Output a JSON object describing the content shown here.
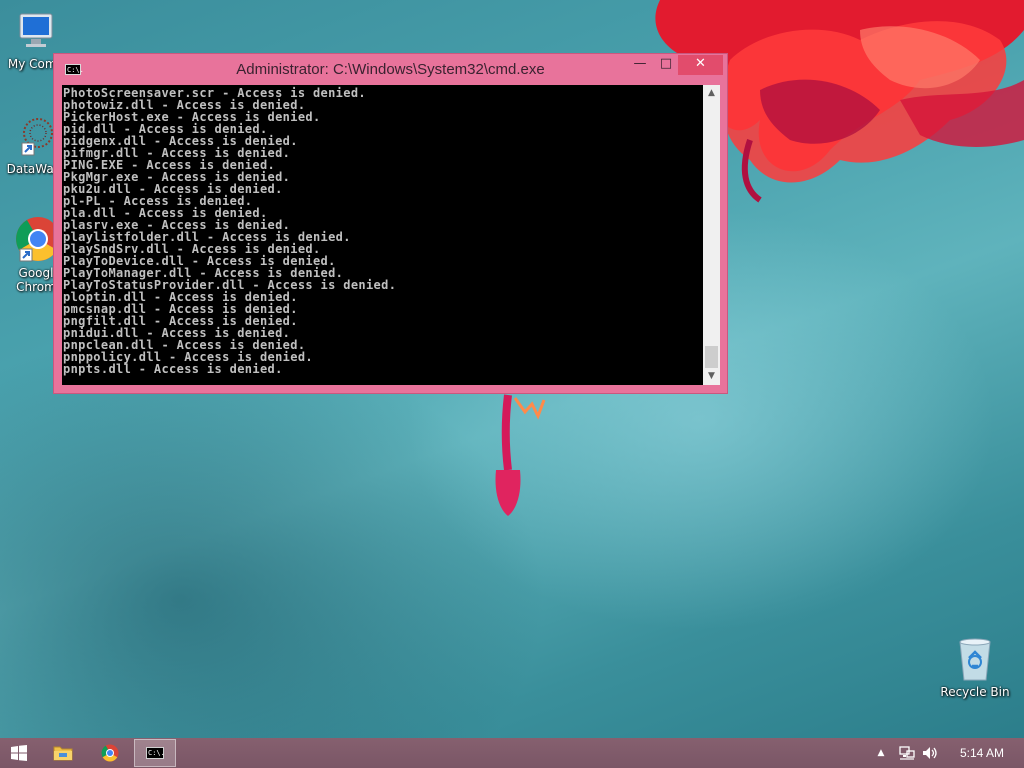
{
  "desktop": {
    "icons": [
      {
        "label": "My Comp",
        "icon": "computer-icon"
      },
      {
        "label": "DataWag",
        "icon": "datawag-icon"
      },
      {
        "label": "Googl",
        "label2": "Chrom",
        "icon": "chrome-icon"
      },
      {
        "label": "Recycle Bin",
        "icon": "recycle-bin-icon"
      }
    ]
  },
  "window": {
    "title": "Administrator:  C:\\Windows\\System32\\cmd.exe",
    "icon_text": "C:\\.",
    "minimize_glyph": "—",
    "maximize_glyph": "□",
    "close_glyph": "✕"
  },
  "console": {
    "lines": [
      "PhotoScreensaver.scr - Access is denied.",
      "photowiz.dll - Access is denied.",
      "PickerHost.exe - Access is denied.",
      "pid.dll - Access is denied.",
      "pidgenx.dll - Access is denied.",
      "pifmgr.dll - Access is denied.",
      "PING.EXE - Access is denied.",
      "PkgMgr.exe - Access is denied.",
      "pku2u.dll - Access is denied.",
      "pl-PL - Access is denied.",
      "pla.dll - Access is denied.",
      "plasrv.exe - Access is denied.",
      "playlistfolder.dll - Access is denied.",
      "PlaySndSrv.dll - Access is denied.",
      "PlayToDevice.dll - Access is denied.",
      "PlayToManager.dll - Access is denied.",
      "PlayToStatusProvider.dll - Access is denied.",
      "ploptin.dll - Access is denied.",
      "pmcsnap.dll - Access is denied.",
      "pngfilt.dll - Access is denied.",
      "pnidui.dll - Access is denied.",
      "pnpclean.dll - Access is denied.",
      "pnppolicy.dll - Access is denied.",
      "pnpts.dll - Access is denied."
    ]
  },
  "taskbar": {
    "items": [
      "start-icon",
      "file-explorer-icon",
      "chrome-icon",
      "cmd-icon"
    ],
    "cmd_icon_text": "C:\\.",
    "tray": {
      "chevron": "▲",
      "clock": "5:14 AM"
    }
  },
  "colors": {
    "window_frame": "#e8739b",
    "close_button": "#e24c6c",
    "console_bg": "#000000",
    "console_text": "#c0c0c0",
    "taskbar": "#7f5a6a"
  }
}
